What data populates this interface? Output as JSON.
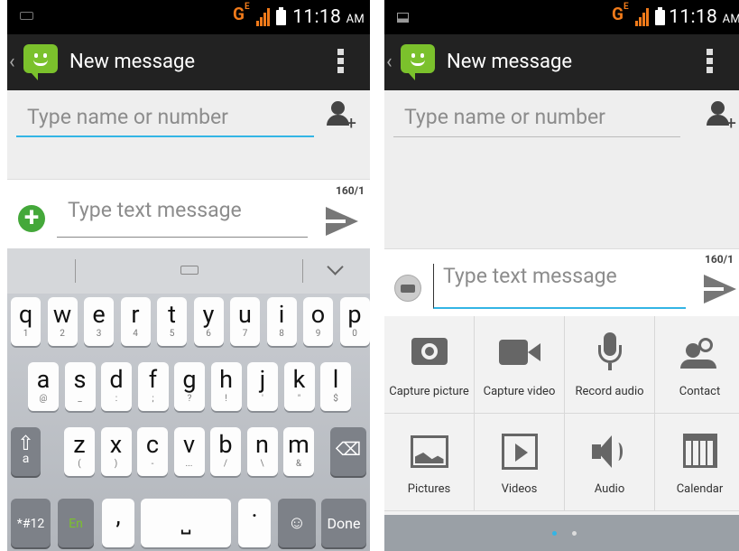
{
  "left": {
    "status": {
      "network": "G",
      "network_sup": "E",
      "time": "11:18",
      "ampm": "AM"
    },
    "action_bar": {
      "title": "New message"
    },
    "recipient": {
      "placeholder": "Type name or number"
    },
    "compose": {
      "counter": "160/1",
      "placeholder": "Type text message"
    },
    "keyboard": {
      "row1": [
        {
          "m": "q",
          "s": "1"
        },
        {
          "m": "w",
          "s": "2"
        },
        {
          "m": "e",
          "s": "3"
        },
        {
          "m": "r",
          "s": "4"
        },
        {
          "m": "t",
          "s": "5"
        },
        {
          "m": "y",
          "s": "6"
        },
        {
          "m": "u",
          "s": "7"
        },
        {
          "m": "i",
          "s": "8"
        },
        {
          "m": "o",
          "s": "9"
        },
        {
          "m": "p",
          "s": "0"
        }
      ],
      "row2": [
        {
          "m": "a",
          "s": "@"
        },
        {
          "m": "s",
          "s": "_"
        },
        {
          "m": "d",
          "s": ":"
        },
        {
          "m": "f",
          "s": ";"
        },
        {
          "m": "g",
          "s": "?"
        },
        {
          "m": "h",
          "s": "!"
        },
        {
          "m": "j",
          "s": "'"
        },
        {
          "m": "k",
          "s": "\""
        },
        {
          "m": "l",
          "s": "$"
        }
      ],
      "row3": [
        {
          "m": "z",
          "s": "("
        },
        {
          "m": "x",
          "s": ")"
        },
        {
          "m": "c",
          "s": "-"
        },
        {
          "m": "v",
          "s": "..."
        },
        {
          "m": "b",
          "s": "/"
        },
        {
          "m": "n",
          "s": "\\"
        },
        {
          "m": "m",
          "s": "&"
        }
      ],
      "shift_sub": "a",
      "sym_label": "*#12",
      "lang_label": "En",
      "comma": ",",
      "period": "·",
      "done_label": "Done"
    }
  },
  "right": {
    "status": {
      "network": "G",
      "network_sup": "E",
      "time": "11:18",
      "ampm": "AM"
    },
    "action_bar": {
      "title": "New message"
    },
    "recipient": {
      "placeholder": "Type name or number"
    },
    "compose": {
      "counter": "160/1",
      "placeholder": "Type text message"
    },
    "attachments": [
      {
        "label": "Capture picture",
        "icon": "camera-icon"
      },
      {
        "label": "Capture video",
        "icon": "video-camera-icon"
      },
      {
        "label": "Record audio",
        "icon": "microphone-icon"
      },
      {
        "label": "Contact",
        "icon": "contact-icon"
      },
      {
        "label": "Pictures",
        "icon": "picture-icon"
      },
      {
        "label": "Videos",
        "icon": "video-file-icon"
      },
      {
        "label": "Audio",
        "icon": "speaker-icon"
      },
      {
        "label": "Calendar",
        "icon": "calendar-icon"
      }
    ],
    "page_indicator": {
      "pages": 2,
      "active": 0
    }
  },
  "colors": {
    "accent_blue": "#33b5e5",
    "brand_green": "#7bc12c",
    "signal_orange": "#f07a1a"
  }
}
